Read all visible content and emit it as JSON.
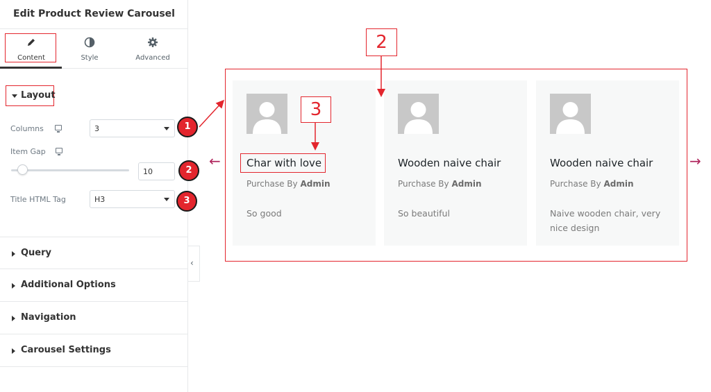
{
  "panel": {
    "title": "Edit Product Review Carousel",
    "tabs": [
      {
        "label": "Content",
        "icon": "pencil-icon"
      },
      {
        "label": "Style",
        "icon": "half-circle-icon"
      },
      {
        "label": "Advanced",
        "icon": "gear-icon"
      }
    ],
    "layout": {
      "heading": "Layout",
      "columns_label": "Columns",
      "columns_value": "3",
      "item_gap_label": "Item Gap",
      "item_gap_value": "10",
      "title_tag_label": "Title HTML Tag",
      "title_tag_value": "H3"
    },
    "sections": [
      "Query",
      "Additional Options",
      "Navigation",
      "Carousel Settings"
    ]
  },
  "annotations": {
    "badges": [
      "1",
      "2",
      "3"
    ],
    "callouts": [
      "2",
      "3"
    ]
  },
  "preview": {
    "cards": [
      {
        "title": "Char with love",
        "meta_prefix": "Purchase By",
        "meta_author": "Admin",
        "body": "So good"
      },
      {
        "title": "Wooden naive chair",
        "meta_prefix": "Purchase By",
        "meta_author": "Admin",
        "body": "So beautiful"
      },
      {
        "title": "Wooden naive chair",
        "meta_prefix": "Purchase By",
        "meta_author": "Admin",
        "body": "Naive wooden chair, very nice design"
      }
    ],
    "prev_arrow": "←",
    "next_arrow": "→"
  },
  "colors": {
    "annotation_red": "#e3252d",
    "arrow_magenta": "#b0275e",
    "card_bg": "#f7f8f8"
  }
}
